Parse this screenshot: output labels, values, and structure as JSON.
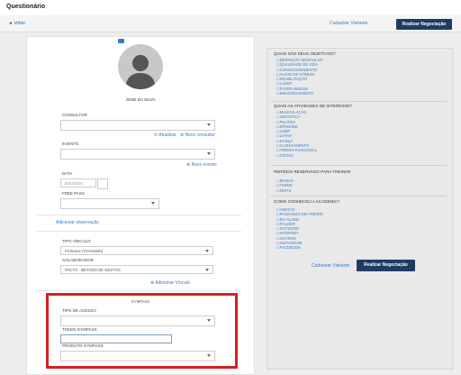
{
  "header": {
    "title": "Questionário"
  },
  "subbar": {
    "back_label": "◄ Voltar",
    "cadastrar_label": "Cadastrar Visitante",
    "realizar_label": "Realizar Negociação"
  },
  "profile": {
    "name": "JOSE DA SILVA"
  },
  "form": {
    "consultor_label": "CONSULTOR",
    "atualizar_label": "⟳ Atualizar",
    "novo_consultor_label": "⊕ Novo consultor",
    "evento_label": "EVENTO",
    "novo_evento_label": "⊕ Novo evento",
    "data_label": "DATA",
    "data_value": "15/07/2020",
    "free_pass_label": "FREE PASS",
    "adicionar_obs_label": "Adicionar observação",
    "tipo_vinculo_label": "TIPO VÍNCULO",
    "tipo_vinculo_value": "Professor (TreinoWeb)",
    "colaborador_label": "COLABORADOR",
    "colaborador_value": "PACTO - MÉTODO DE GESTÃO",
    "adicionar_vinculo_label": "⊕ Adicionar Vínculo"
  },
  "gympass": {
    "section_title": "GYMPASS",
    "tipo_acesso_label": "TIPO DE ACESSO",
    "token_label": "TOKEN GYMPASS",
    "produto_label": "PRODUTO GYMPASS"
  },
  "questions": [
    {
      "title": "QUAIS SÃO SEUS OBJETIVOS?",
      "options": [
        "DEFINIÇÃO MUSCULAR",
        "QUALIDADE DE VIDA",
        "CONDICIONAMENTO",
        "ALIVIO DE STRESS",
        "REABILITAÇÃO",
        "LAZER",
        "FAZER AMIGOS",
        "EMAGRECIMENTO"
      ]
    },
    {
      "title": "QUAIS AS ATIVIDADES DE INTERESSE?",
      "options": [
        "MUSCULAÇÃO",
        "GINÁSTICA",
        "PILATES",
        "SPINNING",
        "JUMP",
        "LUTAS",
        "DANÇA",
        "ALONGAMENTO",
        "TREINO FUNCIONAL",
        "CROSS"
      ]
    },
    {
      "title": "PERÍODO RESERVADO PARA TREINAR",
      "options": [
        "MANHÃ",
        "TARDE",
        "NOITE"
      ]
    },
    {
      "title": "COMO CONHECEU A ACADEMIA?",
      "options": [
        "AMIGOS",
        "PASSANDO EM FRENTE",
        "EX-ALUNO",
        "FOLDER",
        "OUTDOOR",
        "INTERNET",
        "OUTROS",
        "INSTAGRAM",
        "FACEBOOK"
      ]
    }
  ],
  "footer_actions": {
    "cadastrar_label": "Cadastrar Visitante",
    "realizar_label": "Realizar Negociação"
  }
}
